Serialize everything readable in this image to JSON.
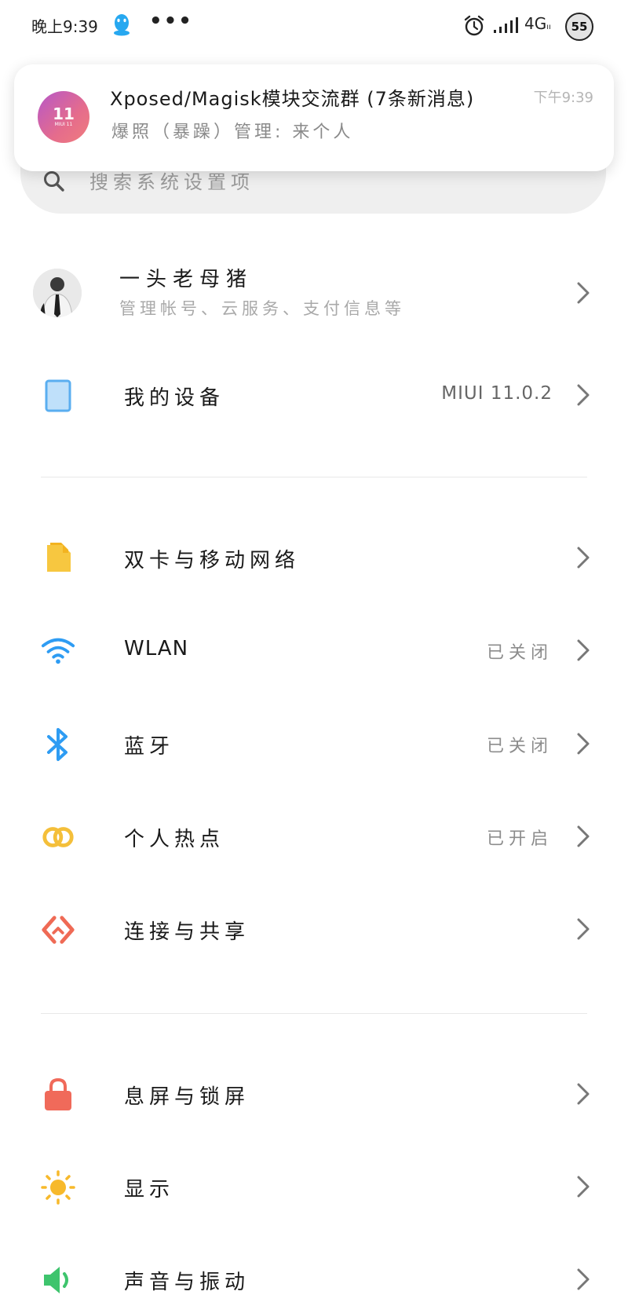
{
  "status_bar": {
    "time": "晚上9:39",
    "overflow": "•••",
    "network": "4G",
    "network_sub": "ıı",
    "battery": "55"
  },
  "notification": {
    "title": "Xposed/Magisk模块交流群 (7条新消息)",
    "text": "爆照（暴躁）管理: 来个人",
    "time": "下午9:39",
    "avatar_big": "11",
    "avatar_small": "MIUI 11"
  },
  "search": {
    "placeholder": "搜索系统设置项"
  },
  "account": {
    "name": "一头老母猪",
    "subtitle": "管理帐号、云服务、支付信息等"
  },
  "items": [
    {
      "label": "我的设备",
      "value": "MIUI 11.0.2",
      "icon": "device-icon",
      "color": "#5aaef0"
    },
    {
      "label": "双卡与移动网络",
      "value": "",
      "icon": "sim-card-icon",
      "color": "#f7c740"
    },
    {
      "label": "WLAN",
      "value": "已关闭",
      "icon": "wifi-icon",
      "color": "#2e9cf3"
    },
    {
      "label": "蓝牙",
      "value": "已关闭",
      "icon": "bluetooth-icon",
      "color": "#2e9cf3"
    },
    {
      "label": "个人热点",
      "value": "已开启",
      "icon": "hotspot-icon",
      "color": "#f4bf3a"
    },
    {
      "label": "连接与共享",
      "value": "",
      "icon": "connection-share-icon",
      "color": "#ef6a55"
    },
    {
      "label": "息屏与锁屏",
      "value": "",
      "icon": "lock-icon",
      "color": "#f06a5a"
    },
    {
      "label": "显示",
      "value": "",
      "icon": "sun-icon",
      "color": "#f7b92b"
    },
    {
      "label": "声音与振动",
      "value": "",
      "icon": "speaker-icon",
      "color": "#3ec46d"
    }
  ]
}
